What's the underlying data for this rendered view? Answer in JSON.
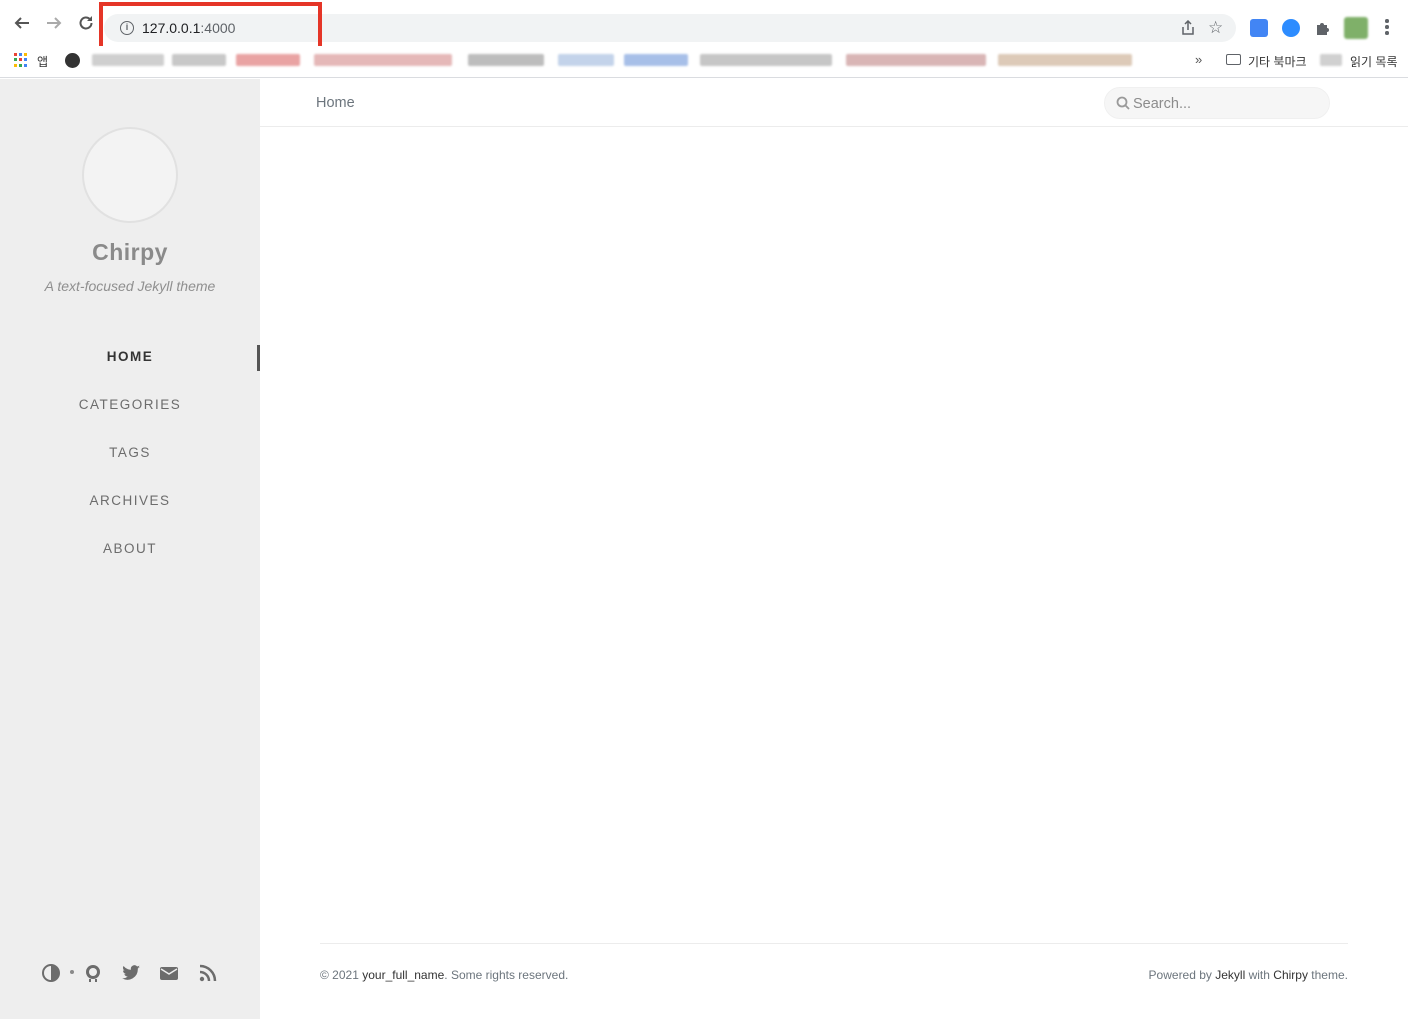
{
  "browser": {
    "url_host": "127.0.0.1",
    "url_port": ":4000",
    "bookmarks": {
      "apps_label": "앱",
      "folder_label": "기타 북마크",
      "reading_list_label": "읽기 목록",
      "more_label": "»"
    }
  },
  "sidebar": {
    "title": "Chirpy",
    "subtitle": "A text-focused Jekyll theme",
    "nav": [
      {
        "label": "HOME",
        "active": true
      },
      {
        "label": "CATEGORIES",
        "active": false
      },
      {
        "label": "TAGS",
        "active": false
      },
      {
        "label": "ARCHIVES",
        "active": false
      },
      {
        "label": "ABOUT",
        "active": false
      }
    ],
    "icons": [
      "theme-toggle-icon",
      "github-icon",
      "twitter-icon",
      "email-icon",
      "rss-icon"
    ]
  },
  "topbar": {
    "breadcrumb": "Home",
    "search_placeholder": "Search..."
  },
  "footer": {
    "copyright_prefix": "© 2021 ",
    "author": "your_full_name",
    "copyright_suffix": ". Some rights reserved.",
    "powered_prefix": "Powered by ",
    "jekyll": "Jekyll",
    "powered_with": " with ",
    "chirpy": "Chirpy",
    "powered_suffix": " theme."
  },
  "colors": {
    "sidebar_bg": "#eeeeee",
    "highlight_box": "#e53527",
    "text_muted": "#6c757d"
  }
}
